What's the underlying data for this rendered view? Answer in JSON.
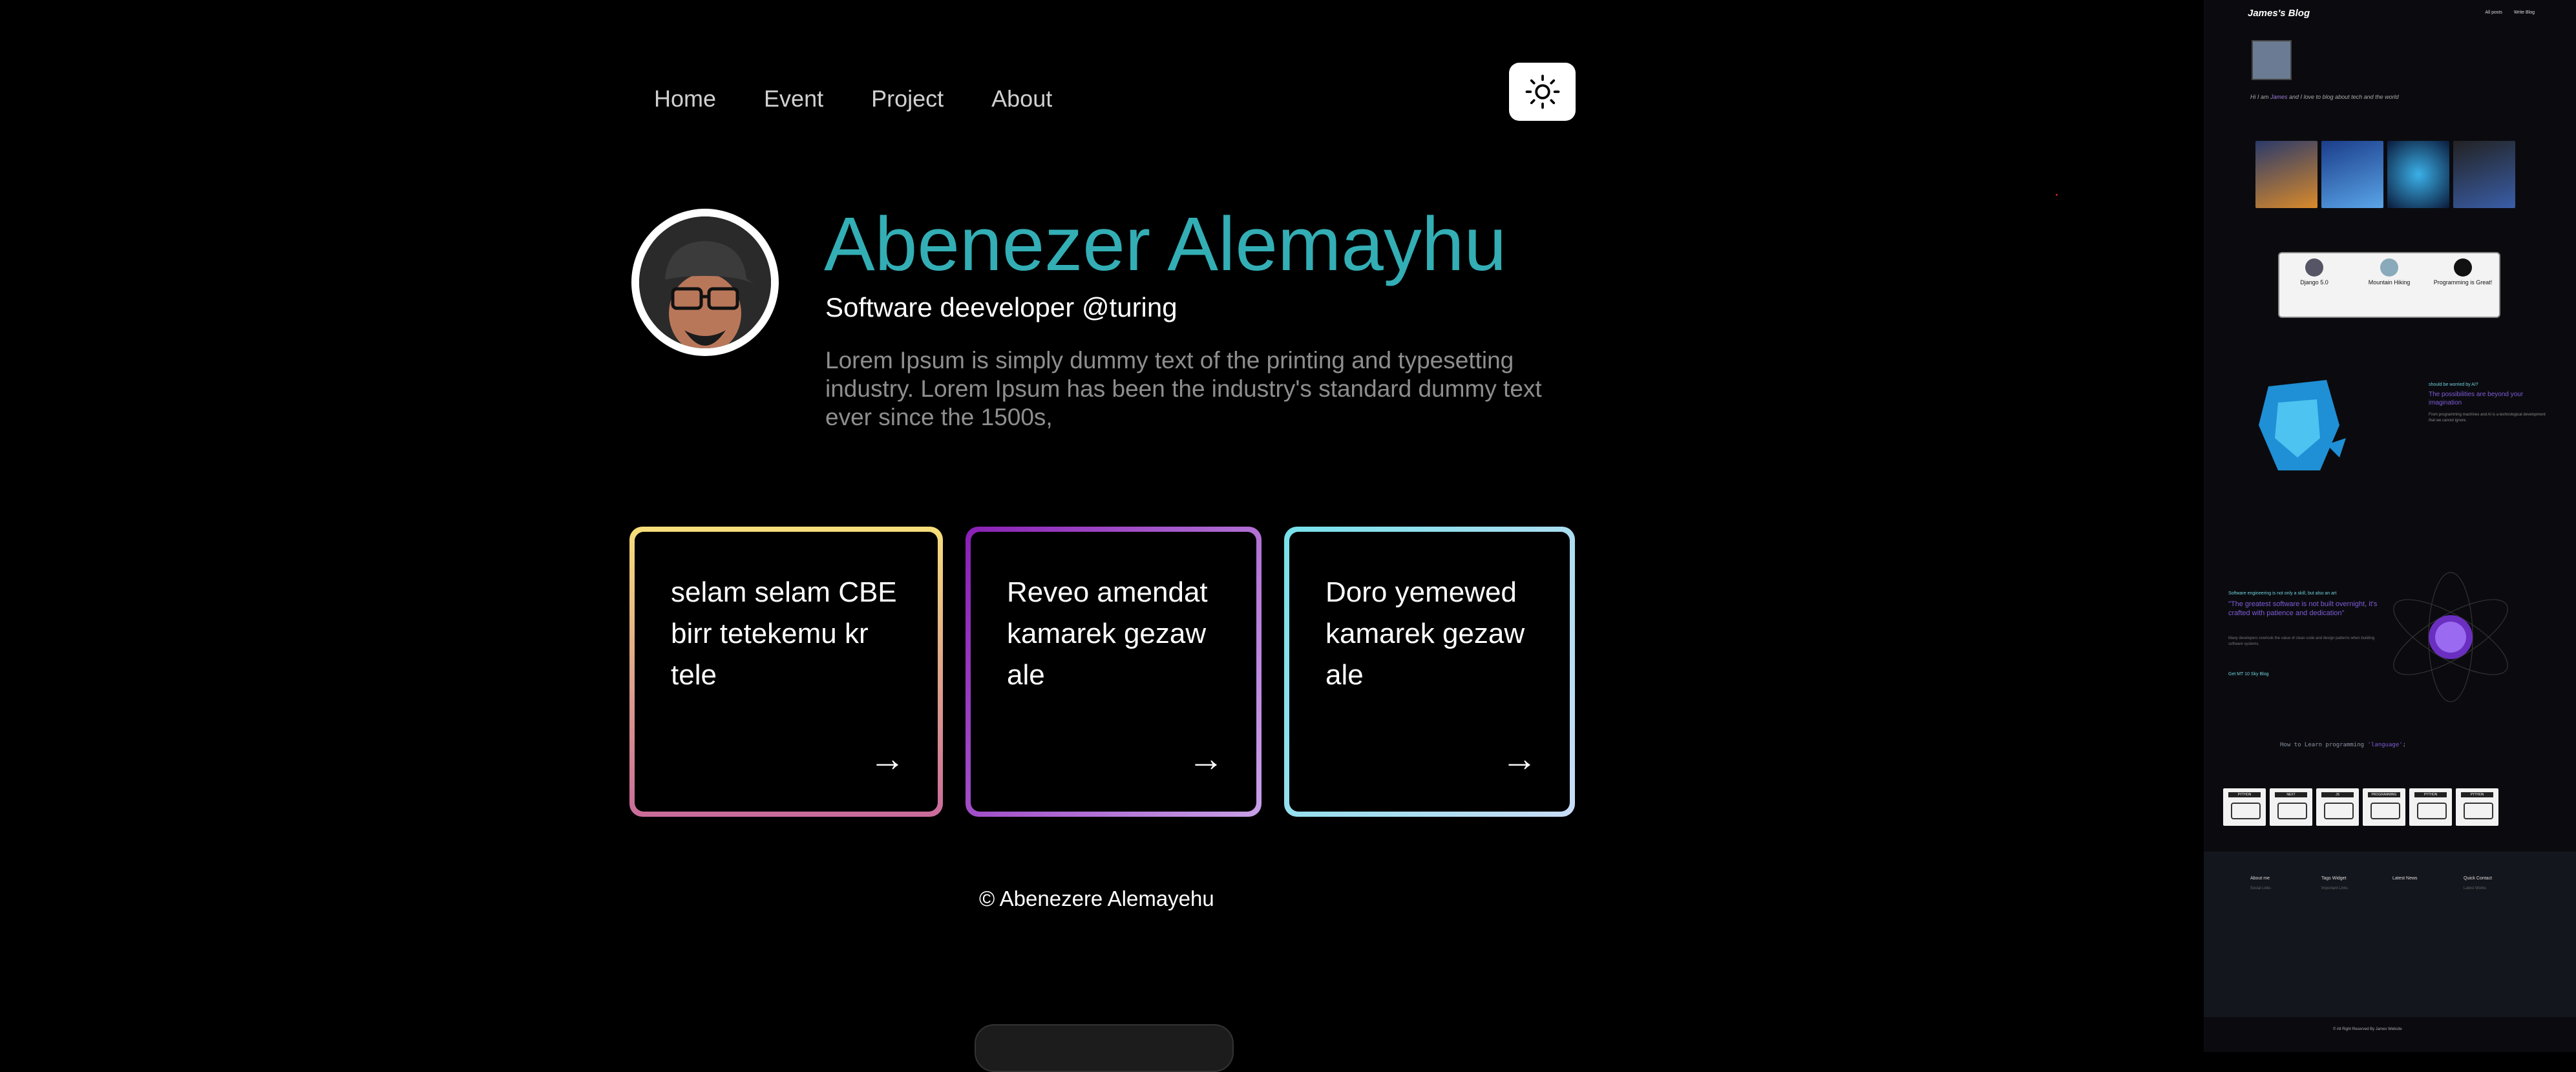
{
  "nav": {
    "items": [
      "Home",
      "Event",
      "Project",
      "About"
    ]
  },
  "hero": {
    "name": "Abenezer Alemayhu",
    "role": "Software deeveloper @turing",
    "description": "Lorem Ipsum is simply dummy text of the printing and typesetting industry. Lorem Ipsum has been the industry's standard dummy text ever since the 1500s,"
  },
  "cards": [
    {
      "text": "selam selam CBE birr tetekemu kr tele",
      "arrow": "→",
      "border_from": "#f7df7a",
      "border_to": "#c96b9a"
    },
    {
      "text": "Reveo amendat kamarek gezaw ale",
      "arrow": "→",
      "border_from": "#8a1fb5",
      "border_to": "#c9a0e8"
    },
    {
      "text": "Doro yemewed kamarek gezaw ale",
      "arrow": "→",
      "border_from": "#76e1ea",
      "border_to": "#c9dcf5"
    }
  ],
  "footer": {
    "copyright": "© Abenezere Alemayehu"
  },
  "colors": {
    "accent": "#33aeb5",
    "background": "#000000"
  },
  "blog": {
    "title": "James's Blog",
    "nav": [
      "All posts",
      "Write Blog"
    ],
    "intro_prefix": "Hi I am ",
    "intro_em": "James",
    "intro_suffix": " and I love to blog about tech and the world",
    "categories": [
      {
        "label": "Django 5.0"
      },
      {
        "label": "Mountain Hiking"
      },
      {
        "label": "Programming is Great!"
      }
    ],
    "ai_kicker": "should be worried by AI?",
    "ai_headline": "The possibilities are beyond your imagination",
    "ai_body": "From programming machines and AI is a technological development that we cannot ignore.",
    "quote_kicker": "Software engineering is not only a skill, but also an art",
    "quote": "\"The greatest software is not built overnight, it's crafted with patience and dedication\"",
    "quote_body": "Many developers overlook the value of clean code and design patterns when building software systems.",
    "quote_link": "Get MT 10 Sky Blog",
    "code_prefix": "How to Learn programming ",
    "code_em": "'language'",
    "code_suffix": ";",
    "card_tags": [
      "PYTHON",
      "NEXT",
      "JS",
      "PROGRAMMING",
      "PYTHON",
      "PYTHON"
    ],
    "footer_cols": [
      "About me",
      "Tags Widget",
      "Latest News",
      "Quick Contact"
    ],
    "footer_sub": [
      "Social Links",
      "Important Links",
      "",
      "Latest Works"
    ],
    "bottom": "© All Right Reserved By James Website"
  }
}
